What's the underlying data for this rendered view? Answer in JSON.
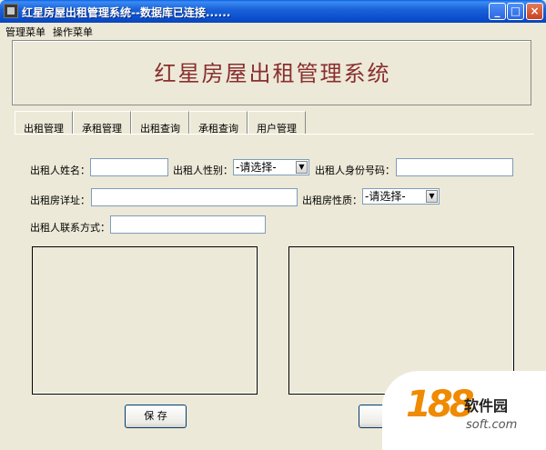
{
  "window": {
    "title": "红星房屋出租管理系统--数据库已连接......",
    "min_glyph": "_",
    "max_glyph": "□",
    "close_glyph": "×"
  },
  "menu": [
    "管理菜单",
    "操作菜单"
  ],
  "banner": {
    "title": "红星房屋出租管理系统"
  },
  "tabs": [
    "出租管理",
    "承租管理",
    "出租查询",
    "承租查询",
    "用户管理"
  ],
  "form": {
    "name_label": "出租人姓名：",
    "gender_label": "出租人性别：",
    "gender_value": "-请选择-",
    "id_label": "出租人身份号码：",
    "address_label": "出租房详址：",
    "property_label": "出租房性质：",
    "property_value": "-请选择-",
    "contact_label": "出租人联系方式："
  },
  "buttons": {
    "save": "保 存",
    "reset": "重"
  },
  "watermark": {
    "number": "188",
    "name": "软件园",
    "url": "soft.com"
  }
}
